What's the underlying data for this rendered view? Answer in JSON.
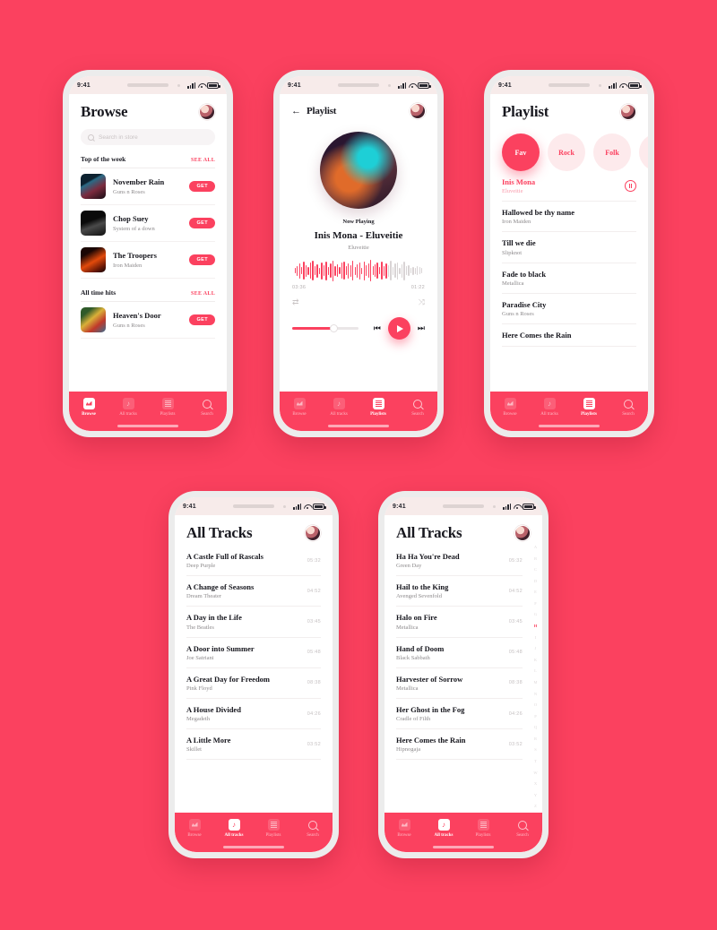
{
  "theme": {
    "accent": "#fb415f",
    "bg": "#fb415f",
    "screen_bg": "#ffffff",
    "muted": "#8d8a8c"
  },
  "status_bar": {
    "time": "9:41",
    "signal": "signal-bars",
    "wifi": "wifi",
    "battery": "battery-full"
  },
  "tabs": [
    {
      "label": "Browse",
      "icon": "browse-icon"
    },
    {
      "label": "All tracks",
      "icon": "music-note-icon"
    },
    {
      "label": "Playlists",
      "icon": "list-icon"
    },
    {
      "label": "Search",
      "icon": "search-icon"
    }
  ],
  "browse": {
    "title": "Browse",
    "search_placeholder": "Search in store",
    "sections": [
      {
        "title": "Top of the week",
        "see_all": "SEE ALL",
        "tracks": [
          {
            "title": "November Rain",
            "artist": "Guns n Roses",
            "action": "GET",
            "art": "a1"
          },
          {
            "title": "Chop Suey",
            "artist": "System of a down",
            "action": "GET",
            "art": "a2"
          },
          {
            "title": "The Troopers",
            "artist": "Iron Maiden",
            "action": "GET",
            "art": "a3"
          }
        ]
      },
      {
        "title": "All time hits",
        "see_all": "SEE ALL",
        "tracks": [
          {
            "title": "Heaven's Door",
            "artist": "Guns n Roses",
            "action": "GET",
            "art": "a4"
          }
        ]
      }
    ],
    "active_tab": "Browse"
  },
  "player": {
    "header_title": "Playlist",
    "back": "back-arrow",
    "now_playing_label": "Now Playing",
    "track_title": "Inis Mona - Eluveitie",
    "artist": "Eluveitie",
    "elapsed": "03:36",
    "remaining": "01:22",
    "repeat_icon": "repeat-icon",
    "shuffle_icon": "shuffle-icon",
    "prev_icon": "previous-icon",
    "next_icon": "next-icon",
    "play_icon": "play-icon",
    "volume_percent": 62,
    "active_tab": "Playlists"
  },
  "playlist": {
    "title": "Playlist",
    "categories": [
      {
        "label": "Fav",
        "active": true
      },
      {
        "label": "Rock",
        "active": false
      },
      {
        "label": "Folk",
        "active": false
      },
      {
        "label": "",
        "active": false
      }
    ],
    "tracks": [
      {
        "title": "Inis Mona",
        "artist": "Eluveitie",
        "current": true
      },
      {
        "title": "Hallowed be thy name",
        "artist": "Iron Maiden",
        "current": false
      },
      {
        "title": "Till we die",
        "artist": "Slipknot",
        "current": false
      },
      {
        "title": "Fade to black",
        "artist": "Metallica",
        "current": false
      },
      {
        "title": "Paradise City",
        "artist": "Guns n Roses",
        "current": false
      },
      {
        "title": "Here Comes the Rain",
        "artist": "",
        "current": false
      }
    ],
    "active_tab": "Playlists"
  },
  "all_tracks_a": {
    "title": "All Tracks",
    "tracks": [
      {
        "title": "A Castle Full of Rascals",
        "artist": "Deep Purple",
        "duration": "05:32"
      },
      {
        "title": "A Change of Seasons",
        "artist": "Dream Theater",
        "duration": "04:52"
      },
      {
        "title": "A Day in the Life",
        "artist": "The Beatles",
        "duration": "03:45"
      },
      {
        "title": "A Door into Summer",
        "artist": "Joe Satriani",
        "duration": "05:48"
      },
      {
        "title": "A Great Day for Freedom",
        "artist": "Pink Floyd",
        "duration": "08:38"
      },
      {
        "title": "A House Divided",
        "artist": "Megadeth",
        "duration": "04:26"
      },
      {
        "title": "A Little More",
        "artist": "Skillet",
        "duration": "03:52"
      }
    ],
    "active_tab": "All tracks"
  },
  "all_tracks_h": {
    "title": "All Tracks",
    "tracks": [
      {
        "title": "Ha Ha You're Dead",
        "artist": "Green Day",
        "duration": "05:32"
      },
      {
        "title": "Hail to the King",
        "artist": "Avenged Sevenfold",
        "duration": "04:52"
      },
      {
        "title": "Halo on Fire",
        "artist": "Metallica",
        "duration": "03:45"
      },
      {
        "title": "Hand of Doom",
        "artist": "Black Sabbath",
        "duration": "05:48"
      },
      {
        "title": "Harvester of Sorrow",
        "artist": "Metallica",
        "duration": "08:38"
      },
      {
        "title": "Her Ghost in the Fog",
        "artist": "Cradle of Filth",
        "duration": "04:26"
      },
      {
        "title": "Here Comes the Rain",
        "artist": "Hipnogaja",
        "duration": "03:52"
      }
    ],
    "alpha_index": [
      "A",
      "B",
      "C",
      "D",
      "E",
      "F",
      "G",
      "H",
      "I",
      "J",
      "K",
      "L",
      "M",
      "N",
      "O",
      "P",
      "Q",
      "R",
      "S",
      "T",
      "W",
      "X",
      "Y",
      "Z"
    ],
    "alpha_active": "H",
    "active_tab": "All tracks"
  }
}
